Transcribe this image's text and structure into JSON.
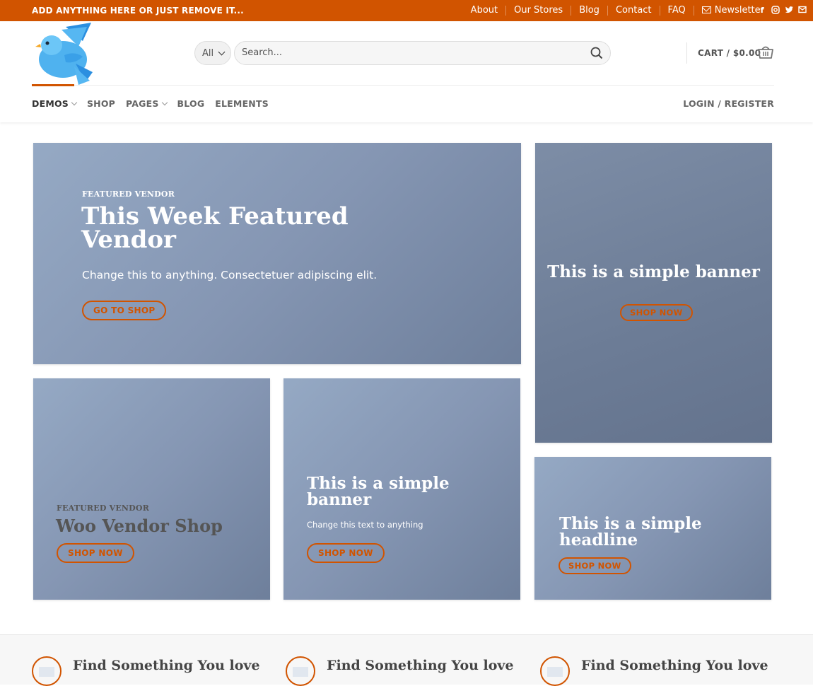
{
  "topbar": {
    "promo": "ADD ANYTHING HERE OR JUST REMOVE IT...",
    "links": [
      "About",
      "Our Stores",
      "Blog",
      "Contact",
      "FAQ"
    ],
    "newsletter": "Newsletter",
    "social": [
      "facebook-icon",
      "instagram-icon",
      "twitter-icon",
      "email-icon"
    ],
    "color": "#d15400"
  },
  "header": {
    "category_select": "All",
    "search_placeholder": "Search...",
    "cart_label": "CART / $0.00"
  },
  "nav": {
    "items": [
      "DEMOS",
      "SHOP",
      "PAGES",
      "BLOG",
      "ELEMENTS"
    ],
    "login": "LOGIN / REGISTER"
  },
  "banners": {
    "featured": {
      "eyebrow": "FEATURED VENDOR",
      "title": "This Week Featured Vendor",
      "subtitle": "Change this to anything. Consectetuer adipiscing elit.",
      "button": "GO TO SHOP"
    },
    "right_tall": {
      "title": "This is a simple banner",
      "button": "SHOP NOW"
    },
    "vendor_shop": {
      "eyebrow": "FEATURED VENDOR",
      "title": "Woo Vendor Shop",
      "button": "SHOP NOW"
    },
    "simple_banner": {
      "title": "This is a simple banner",
      "subtitle": "Change this text to anything",
      "button": "SHOP NOW"
    },
    "simple_headline": {
      "title": "This is a simple headline",
      "button": "SHOP NOW"
    }
  },
  "features": [
    "Find Something You love",
    "Find Something You love",
    "Find Something You love"
  ]
}
